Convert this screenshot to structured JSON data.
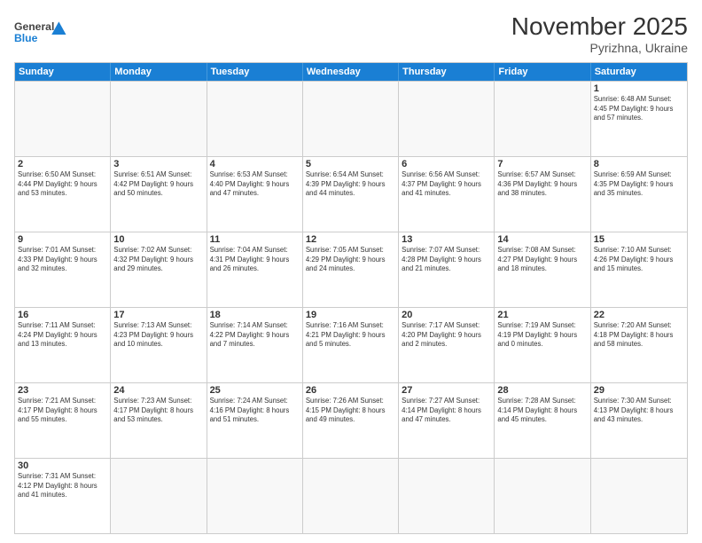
{
  "header": {
    "logo_general": "General",
    "logo_blue": "Blue",
    "title": "November 2025",
    "subtitle": "Pyrizhna, Ukraine"
  },
  "weekdays": [
    "Sunday",
    "Monday",
    "Tuesday",
    "Wednesday",
    "Thursday",
    "Friday",
    "Saturday"
  ],
  "weeks": [
    [
      {
        "day": "",
        "info": ""
      },
      {
        "day": "",
        "info": ""
      },
      {
        "day": "",
        "info": ""
      },
      {
        "day": "",
        "info": ""
      },
      {
        "day": "",
        "info": ""
      },
      {
        "day": "",
        "info": ""
      },
      {
        "day": "1",
        "info": "Sunrise: 6:48 AM\nSunset: 4:45 PM\nDaylight: 9 hours\nand 57 minutes."
      }
    ],
    [
      {
        "day": "2",
        "info": "Sunrise: 6:50 AM\nSunset: 4:44 PM\nDaylight: 9 hours\nand 53 minutes."
      },
      {
        "day": "3",
        "info": "Sunrise: 6:51 AM\nSunset: 4:42 PM\nDaylight: 9 hours\nand 50 minutes."
      },
      {
        "day": "4",
        "info": "Sunrise: 6:53 AM\nSunset: 4:40 PM\nDaylight: 9 hours\nand 47 minutes."
      },
      {
        "day": "5",
        "info": "Sunrise: 6:54 AM\nSunset: 4:39 PM\nDaylight: 9 hours\nand 44 minutes."
      },
      {
        "day": "6",
        "info": "Sunrise: 6:56 AM\nSunset: 4:37 PM\nDaylight: 9 hours\nand 41 minutes."
      },
      {
        "day": "7",
        "info": "Sunrise: 6:57 AM\nSunset: 4:36 PM\nDaylight: 9 hours\nand 38 minutes."
      },
      {
        "day": "8",
        "info": "Sunrise: 6:59 AM\nSunset: 4:35 PM\nDaylight: 9 hours\nand 35 minutes."
      }
    ],
    [
      {
        "day": "9",
        "info": "Sunrise: 7:01 AM\nSunset: 4:33 PM\nDaylight: 9 hours\nand 32 minutes."
      },
      {
        "day": "10",
        "info": "Sunrise: 7:02 AM\nSunset: 4:32 PM\nDaylight: 9 hours\nand 29 minutes."
      },
      {
        "day": "11",
        "info": "Sunrise: 7:04 AM\nSunset: 4:31 PM\nDaylight: 9 hours\nand 26 minutes."
      },
      {
        "day": "12",
        "info": "Sunrise: 7:05 AM\nSunset: 4:29 PM\nDaylight: 9 hours\nand 24 minutes."
      },
      {
        "day": "13",
        "info": "Sunrise: 7:07 AM\nSunset: 4:28 PM\nDaylight: 9 hours\nand 21 minutes."
      },
      {
        "day": "14",
        "info": "Sunrise: 7:08 AM\nSunset: 4:27 PM\nDaylight: 9 hours\nand 18 minutes."
      },
      {
        "day": "15",
        "info": "Sunrise: 7:10 AM\nSunset: 4:26 PM\nDaylight: 9 hours\nand 15 minutes."
      }
    ],
    [
      {
        "day": "16",
        "info": "Sunrise: 7:11 AM\nSunset: 4:24 PM\nDaylight: 9 hours\nand 13 minutes."
      },
      {
        "day": "17",
        "info": "Sunrise: 7:13 AM\nSunset: 4:23 PM\nDaylight: 9 hours\nand 10 minutes."
      },
      {
        "day": "18",
        "info": "Sunrise: 7:14 AM\nSunset: 4:22 PM\nDaylight: 9 hours\nand 7 minutes."
      },
      {
        "day": "19",
        "info": "Sunrise: 7:16 AM\nSunset: 4:21 PM\nDaylight: 9 hours\nand 5 minutes."
      },
      {
        "day": "20",
        "info": "Sunrise: 7:17 AM\nSunset: 4:20 PM\nDaylight: 9 hours\nand 2 minutes."
      },
      {
        "day": "21",
        "info": "Sunrise: 7:19 AM\nSunset: 4:19 PM\nDaylight: 9 hours\nand 0 minutes."
      },
      {
        "day": "22",
        "info": "Sunrise: 7:20 AM\nSunset: 4:18 PM\nDaylight: 8 hours\nand 58 minutes."
      }
    ],
    [
      {
        "day": "23",
        "info": "Sunrise: 7:21 AM\nSunset: 4:17 PM\nDaylight: 8 hours\nand 55 minutes."
      },
      {
        "day": "24",
        "info": "Sunrise: 7:23 AM\nSunset: 4:17 PM\nDaylight: 8 hours\nand 53 minutes."
      },
      {
        "day": "25",
        "info": "Sunrise: 7:24 AM\nSunset: 4:16 PM\nDaylight: 8 hours\nand 51 minutes."
      },
      {
        "day": "26",
        "info": "Sunrise: 7:26 AM\nSunset: 4:15 PM\nDaylight: 8 hours\nand 49 minutes."
      },
      {
        "day": "27",
        "info": "Sunrise: 7:27 AM\nSunset: 4:14 PM\nDaylight: 8 hours\nand 47 minutes."
      },
      {
        "day": "28",
        "info": "Sunrise: 7:28 AM\nSunset: 4:14 PM\nDaylight: 8 hours\nand 45 minutes."
      },
      {
        "day": "29",
        "info": "Sunrise: 7:30 AM\nSunset: 4:13 PM\nDaylight: 8 hours\nand 43 minutes."
      }
    ],
    [
      {
        "day": "30",
        "info": "Sunrise: 7:31 AM\nSunset: 4:12 PM\nDaylight: 8 hours\nand 41 minutes."
      },
      {
        "day": "",
        "info": ""
      },
      {
        "day": "",
        "info": ""
      },
      {
        "day": "",
        "info": ""
      },
      {
        "day": "",
        "info": ""
      },
      {
        "day": "",
        "info": ""
      },
      {
        "day": "",
        "info": ""
      }
    ]
  ]
}
